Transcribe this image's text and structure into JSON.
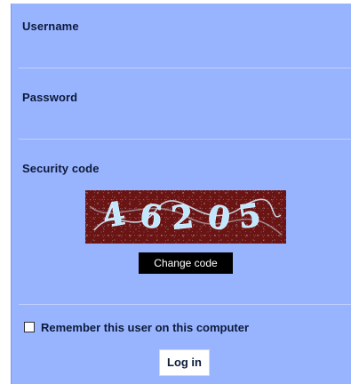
{
  "form": {
    "username_label": "Username",
    "password_label": "Password",
    "security_code_label": "Security code",
    "captcha_text": "46205",
    "change_code_button": "Change code",
    "remember_label": "Remember this user on this computer",
    "remember_checked": false,
    "login_button": "Log in",
    "username_value": "",
    "password_value": ""
  },
  "colors": {
    "panel_bg": "#99b4ff",
    "captcha_bg": "#6a1414",
    "captcha_text": "#bfe8ff",
    "button_dark": "#000000",
    "button_light": "#ffffff"
  },
  "icons": {
    "remember_checkbox": "checkbox-icon"
  }
}
